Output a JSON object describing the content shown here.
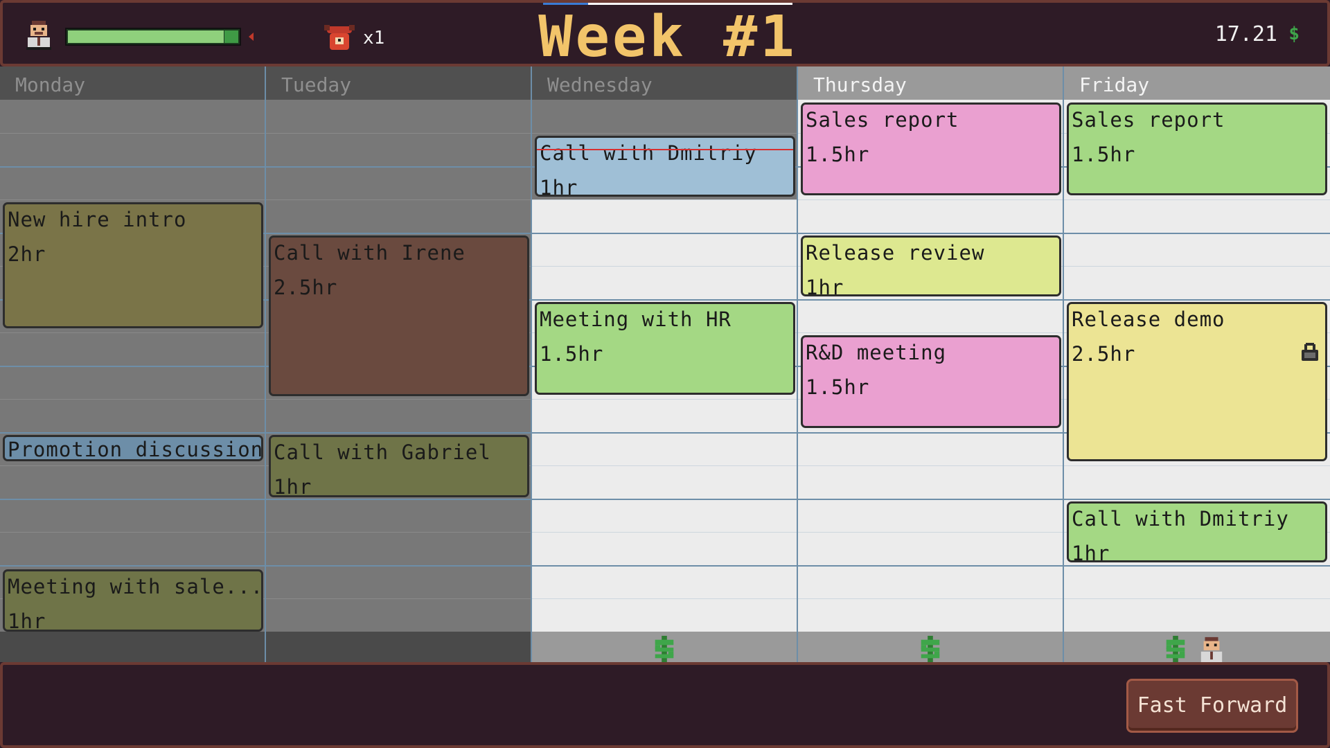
{
  "top_bar": {
    "title": "Week #1",
    "phone_count": "x1",
    "money": "17.21",
    "money_icon": "dollar-icon",
    "energy_level": 0.9,
    "week_progress": 0.18,
    "colors": {
      "title": "#f2c46a",
      "energy": "#8fd07c",
      "money_icon": "#3fa64a"
    }
  },
  "days": [
    {
      "name": "Monday",
      "state": "past"
    },
    {
      "name": "Tueday",
      "state": "past"
    },
    {
      "name": "Wednesday",
      "state": "past"
    },
    {
      "name": "Thursday",
      "state": "current"
    },
    {
      "name": "Friday",
      "state": "future"
    }
  ],
  "events": {
    "monday": [
      {
        "title": "New hire intro",
        "duration": "2hr",
        "color": "#7a7448"
      },
      {
        "title": "Promotion discussion",
        "duration": "",
        "color": "#6d8ea8"
      },
      {
        "title": "Meeting with sale...",
        "duration": "1hr",
        "color": "#6f7448"
      }
    ],
    "tuesday": [
      {
        "title": "Call with Irene",
        "duration": "2.5hr",
        "color": "#6a4a3f"
      },
      {
        "title": "Call with Gabriel",
        "duration": "1hr",
        "color": "#6f7448"
      }
    ],
    "wednesday": [
      {
        "title": "Call with Dmitriy",
        "duration": "1hr",
        "color": "#9fbfd6"
      },
      {
        "title": "Meeting with HR",
        "duration": "1.5hr",
        "color": "#a4d884"
      }
    ],
    "thursday": [
      {
        "title": "Sales report",
        "duration": "1.5hr",
        "color": "#eaa0d0"
      },
      {
        "title": "Release review",
        "duration": "1hr",
        "color": "#dde890"
      },
      {
        "title": "R&D meeting",
        "duration": "1.5hr",
        "color": "#eaa0d0"
      }
    ],
    "friday": [
      {
        "title": "Sales report",
        "duration": "1.5hr",
        "color": "#a4d884"
      },
      {
        "title": "Release demo",
        "duration": "2.5hr",
        "color": "#ece494",
        "locked": true
      },
      {
        "title": "Call with Dmitriy",
        "duration": "1hr",
        "color": "#a4d884"
      }
    ]
  },
  "footer_icons": {
    "wednesday": [
      "dollar-icon"
    ],
    "thursday": [
      "dollar-icon"
    ],
    "friday": [
      "dollar-icon",
      "employee-icon"
    ]
  },
  "bottom_bar": {
    "fast_forward_label": "Fast Forward"
  }
}
